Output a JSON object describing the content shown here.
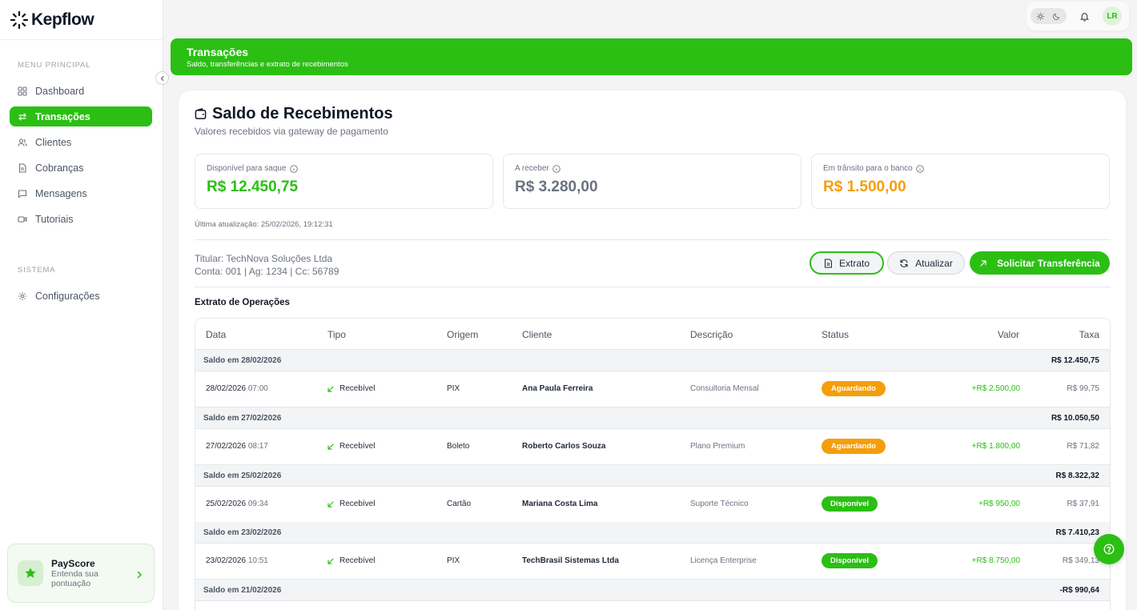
{
  "brand": {
    "name": "Kepflow"
  },
  "sidebar": {
    "section_main": "MENU PRINCIPAL",
    "section_system": "SISTEMA",
    "items": [
      {
        "label": "Dashboard",
        "icon": "dashboard-icon"
      },
      {
        "label": "Transações",
        "icon": "arrows-icon",
        "active": true
      },
      {
        "label": "Clientes",
        "icon": "users-icon"
      },
      {
        "label": "Cobranças",
        "icon": "document-icon"
      },
      {
        "label": "Mensagens",
        "icon": "chat-icon"
      },
      {
        "label": "Tutoriais",
        "icon": "video-icon"
      }
    ],
    "system_items": [
      {
        "label": "Configurações",
        "icon": "gear-icon"
      }
    ],
    "payscore": {
      "title": "PayScore",
      "subtitle": "Entenda sua pontuação"
    }
  },
  "topbar": {
    "avatar_initials": "LR"
  },
  "banner": {
    "title": "Transações",
    "subtitle": "Saldo, transferências e extrato de recebimentos"
  },
  "card": {
    "title": "Saldo de Recebimentos",
    "subtitle": "Valores recebidos via gateway de pagamento",
    "stats": [
      {
        "label": "Disponível para saque",
        "value": "R$ 12.450,75",
        "color": "#2bbf14"
      },
      {
        "label": "A receber",
        "value": "R$ 3.280,00",
        "color": "#6b7280"
      },
      {
        "label": "Em trânsito para o banco",
        "value": "R$ 1.500,00",
        "color": "#f59e0b"
      }
    ],
    "updated": "Última atualização: 25/02/2026, 19:12:31",
    "account": {
      "holder": "Titular: TechNova Soluções Ltda",
      "details": "Conta: 001 | Ag: 1234 | Cc: 56789"
    },
    "buttons": {
      "extrato": "Extrato",
      "atualizar": "Atualizar",
      "transfer": "Solicitar Transferência"
    },
    "section_title": "Extrato de Operações"
  },
  "table": {
    "headers": [
      "Data",
      "Tipo",
      "Origem",
      "Cliente",
      "Descrição",
      "Status",
      "Valor",
      "Taxa"
    ],
    "groups": [
      {
        "label": "Saldo em 28/02/2026",
        "balance": "R$ 12.450,75",
        "row": {
          "date": "28/02/2026",
          "time": "07:00",
          "tipo": "Recebível",
          "origem": "PIX",
          "cliente": "Ana Paula Ferreira",
          "descricao": "Consultoria Mensal",
          "status": "Aguardando",
          "valor": "+R$ 2.500,00",
          "taxa": "R$ 99,75"
        }
      },
      {
        "label": "Saldo em 27/02/2026",
        "balance": "R$ 10.050,50",
        "row": {
          "date": "27/02/2026",
          "time": "08:17",
          "tipo": "Recebível",
          "origem": "Boleto",
          "cliente": "Roberto Carlos Souza",
          "descricao": "Plano Premium",
          "status": "Aguardando",
          "valor": "+R$ 1.800,00",
          "taxa": "R$ 71,82"
        }
      },
      {
        "label": "Saldo em 25/02/2026",
        "balance": "R$ 8.322,32",
        "row": {
          "date": "25/02/2026",
          "time": "09:34",
          "tipo": "Recebível",
          "origem": "Cartão",
          "cliente": "Mariana Costa Lima",
          "descricao": "Suporte Técnico",
          "status": "Disponível",
          "valor": "+R$ 950,00",
          "taxa": "R$ 37,91"
        }
      },
      {
        "label": "Saldo em 23/02/2026",
        "balance": "R$ 7.410,23",
        "row": {
          "date": "23/02/2026",
          "time": "10:51",
          "tipo": "Recebível",
          "origem": "PIX",
          "cliente": "TechBrasil Sistemas Ltda",
          "descricao": "Licença Enterprise",
          "status": "Disponível",
          "valor": "+R$ 8.750,00",
          "taxa": "R$ 349,13"
        }
      },
      {
        "label": "Saldo em 21/02/2026",
        "balance": "-R$ 990,64"
      }
    ]
  },
  "colors": {
    "accent": "#2bbf14",
    "pending": "#f59e0b",
    "available": "#2bbf14"
  }
}
